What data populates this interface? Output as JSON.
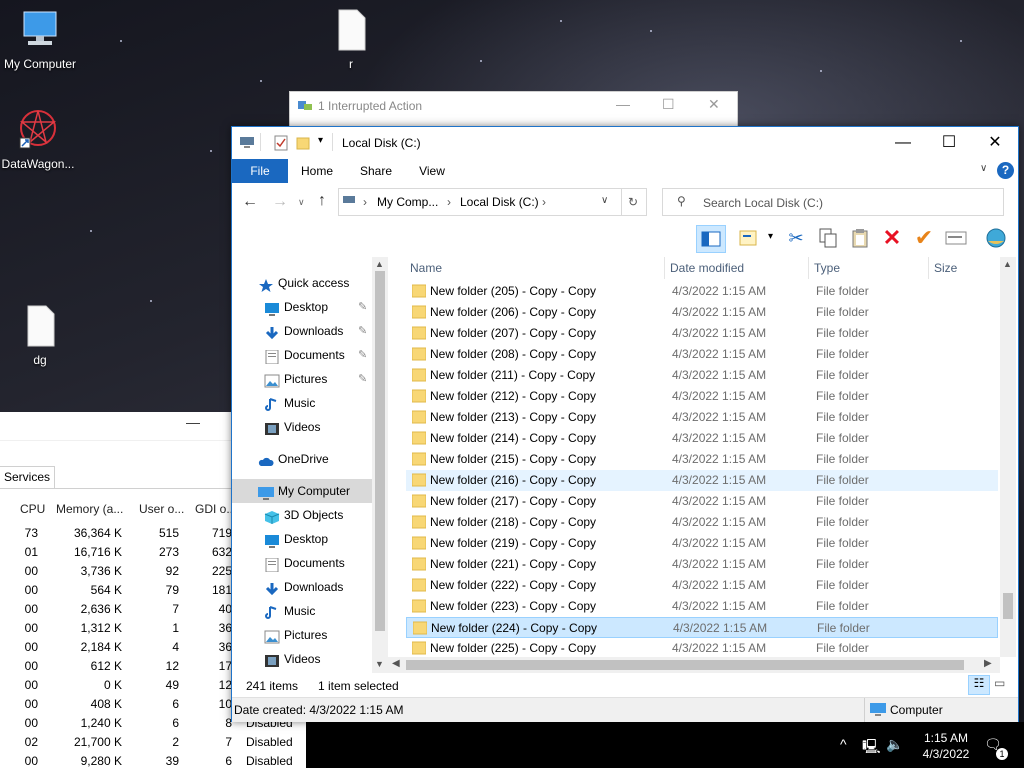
{
  "desktop": {
    "icons": [
      {
        "label": "My Computer",
        "icon": "monitor-icon"
      },
      {
        "label": "r",
        "icon": "blank-file-icon"
      },
      {
        "label": "DataWagon...",
        "icon": "datawagon-logo-icon"
      },
      {
        "label": "dg",
        "icon": "blank-file-icon"
      }
    ]
  },
  "interrupted": {
    "title": "1 Interrupted Action"
  },
  "taskmgr": {
    "tab": "Services",
    "columns": [
      "CPU",
      "Memory (a...",
      "User o...",
      "GDI o..."
    ],
    "rows": [
      {
        "cpu": "73",
        "mem": "36,364 K",
        "user": "515",
        "gdi": "719"
      },
      {
        "cpu": "01",
        "mem": "16,716 K",
        "user": "273",
        "gdi": "632"
      },
      {
        "cpu": "00",
        "mem": "3,736 K",
        "user": "92",
        "gdi": "225"
      },
      {
        "cpu": "00",
        "mem": "564 K",
        "user": "79",
        "gdi": "181"
      },
      {
        "cpu": "00",
        "mem": "2,636 K",
        "user": "7",
        "gdi": "40"
      },
      {
        "cpu": "00",
        "mem": "1,312 K",
        "user": "1",
        "gdi": "36"
      },
      {
        "cpu": "00",
        "mem": "2,184 K",
        "user": "4",
        "gdi": "36"
      },
      {
        "cpu": "00",
        "mem": "612 K",
        "user": "12",
        "gdi": "17"
      },
      {
        "cpu": "00",
        "mem": "0 K",
        "user": "49",
        "gdi": "12"
      },
      {
        "cpu": "00",
        "mem": "408 K",
        "user": "6",
        "gdi": "10"
      },
      {
        "cpu": "00",
        "mem": "1,240 K",
        "user": "6",
        "gdi": "8"
      },
      {
        "cpu": "02",
        "mem": "21,700 K",
        "user": "2",
        "gdi": "7"
      },
      {
        "cpu": "00",
        "mem": "9,280 K",
        "user": "39",
        "gdi": "6"
      }
    ],
    "extra": [
      "Disabled",
      "Disabled",
      "Disabled"
    ]
  },
  "explorer": {
    "title": "Local Disk (C:)",
    "tabs": [
      "File",
      "Home",
      "Share",
      "View"
    ],
    "breadcrumb": [
      "My Comp...",
      "Local Disk (C:)"
    ],
    "search_placeholder": "Search Local Disk (C:)",
    "columns": {
      "name": "Name",
      "date": "Date modified",
      "type": "Type",
      "size": "Size"
    },
    "nav": [
      {
        "label": "Quick access",
        "icon": "star-icon",
        "pinned": false
      },
      {
        "label": "Desktop",
        "icon": "desktop-icon",
        "pinned": true
      },
      {
        "label": "Downloads",
        "icon": "download-icon",
        "pinned": true
      },
      {
        "label": "Documents",
        "icon": "documents-icon",
        "pinned": true
      },
      {
        "label": "Pictures",
        "icon": "pictures-icon",
        "pinned": true
      },
      {
        "label": "Music",
        "icon": "music-icon",
        "pinned": false
      },
      {
        "label": "Videos",
        "icon": "videos-icon",
        "pinned": false
      },
      {
        "label": "OneDrive",
        "icon": "cloud-icon",
        "pinned": false
      },
      {
        "label": "My Computer",
        "icon": "computer-icon",
        "pinned": false
      },
      {
        "label": "3D Objects",
        "icon": "cube-icon",
        "pinned": false
      },
      {
        "label": "Desktop",
        "icon": "desktop-icon",
        "pinned": false
      },
      {
        "label": "Documents",
        "icon": "documents-icon",
        "pinned": false
      },
      {
        "label": "Downloads",
        "icon": "download-icon",
        "pinned": false
      },
      {
        "label": "Music",
        "icon": "music-icon",
        "pinned": false
      },
      {
        "label": "Pictures",
        "icon": "pictures-icon",
        "pinned": false
      },
      {
        "label": "Videos",
        "icon": "videos-icon",
        "pinned": false
      }
    ],
    "files": [
      {
        "name": "New folder (205) - Copy - Copy",
        "date": "4/3/2022 1:15 AM",
        "type": "File folder",
        "state": ""
      },
      {
        "name": "New folder (206) - Copy - Copy",
        "date": "4/3/2022 1:15 AM",
        "type": "File folder",
        "state": ""
      },
      {
        "name": "New folder (207) - Copy - Copy",
        "date": "4/3/2022 1:15 AM",
        "type": "File folder",
        "state": ""
      },
      {
        "name": "New folder (208) - Copy - Copy",
        "date": "4/3/2022 1:15 AM",
        "type": "File folder",
        "state": ""
      },
      {
        "name": "New folder (211) - Copy - Copy",
        "date": "4/3/2022 1:15 AM",
        "type": "File folder",
        "state": ""
      },
      {
        "name": "New folder (212) - Copy - Copy",
        "date": "4/3/2022 1:15 AM",
        "type": "File folder",
        "state": ""
      },
      {
        "name": "New folder (213) - Copy - Copy",
        "date": "4/3/2022 1:15 AM",
        "type": "File folder",
        "state": ""
      },
      {
        "name": "New folder (214) - Copy - Copy",
        "date": "4/3/2022 1:15 AM",
        "type": "File folder",
        "state": ""
      },
      {
        "name": "New folder (215) - Copy - Copy",
        "date": "4/3/2022 1:15 AM",
        "type": "File folder",
        "state": ""
      },
      {
        "name": "New folder (216) - Copy - Copy",
        "date": "4/3/2022 1:15 AM",
        "type": "File folder",
        "state": "hover"
      },
      {
        "name": "New folder (217) - Copy - Copy",
        "date": "4/3/2022 1:15 AM",
        "type": "File folder",
        "state": ""
      },
      {
        "name": "New folder (218) - Copy - Copy",
        "date": "4/3/2022 1:15 AM",
        "type": "File folder",
        "state": ""
      },
      {
        "name": "New folder (219) - Copy - Copy",
        "date": "4/3/2022 1:15 AM",
        "type": "File folder",
        "state": ""
      },
      {
        "name": "New folder (221) - Copy - Copy",
        "date": "4/3/2022 1:15 AM",
        "type": "File folder",
        "state": ""
      },
      {
        "name": "New folder (222) - Copy - Copy",
        "date": "4/3/2022 1:15 AM",
        "type": "File folder",
        "state": ""
      },
      {
        "name": "New folder (223) - Copy - Copy",
        "date": "4/3/2022 1:15 AM",
        "type": "File folder",
        "state": ""
      },
      {
        "name": "New folder (224) - Copy - Copy",
        "date": "4/3/2022 1:15 AM",
        "type": "File folder",
        "state": "selected"
      },
      {
        "name": "New folder (225) - Copy - Copy",
        "date": "4/3/2022 1:15 AM",
        "type": "File folder",
        "state": ""
      }
    ],
    "status": {
      "count": "241 items",
      "selected": "1 item selected"
    },
    "details": {
      "created": "Date created: 4/3/2022 1:15 AM",
      "location": "Computer"
    }
  },
  "taskbar": {
    "time": "1:15 AM",
    "date": "4/3/2022",
    "notifications": "1"
  },
  "colors": {
    "accent": "#1a68c0",
    "selection": "#cce8ff",
    "hover": "#e5f3ff",
    "folder": "#f8d775",
    "delete": "#e81123",
    "check": "#e8841a"
  }
}
